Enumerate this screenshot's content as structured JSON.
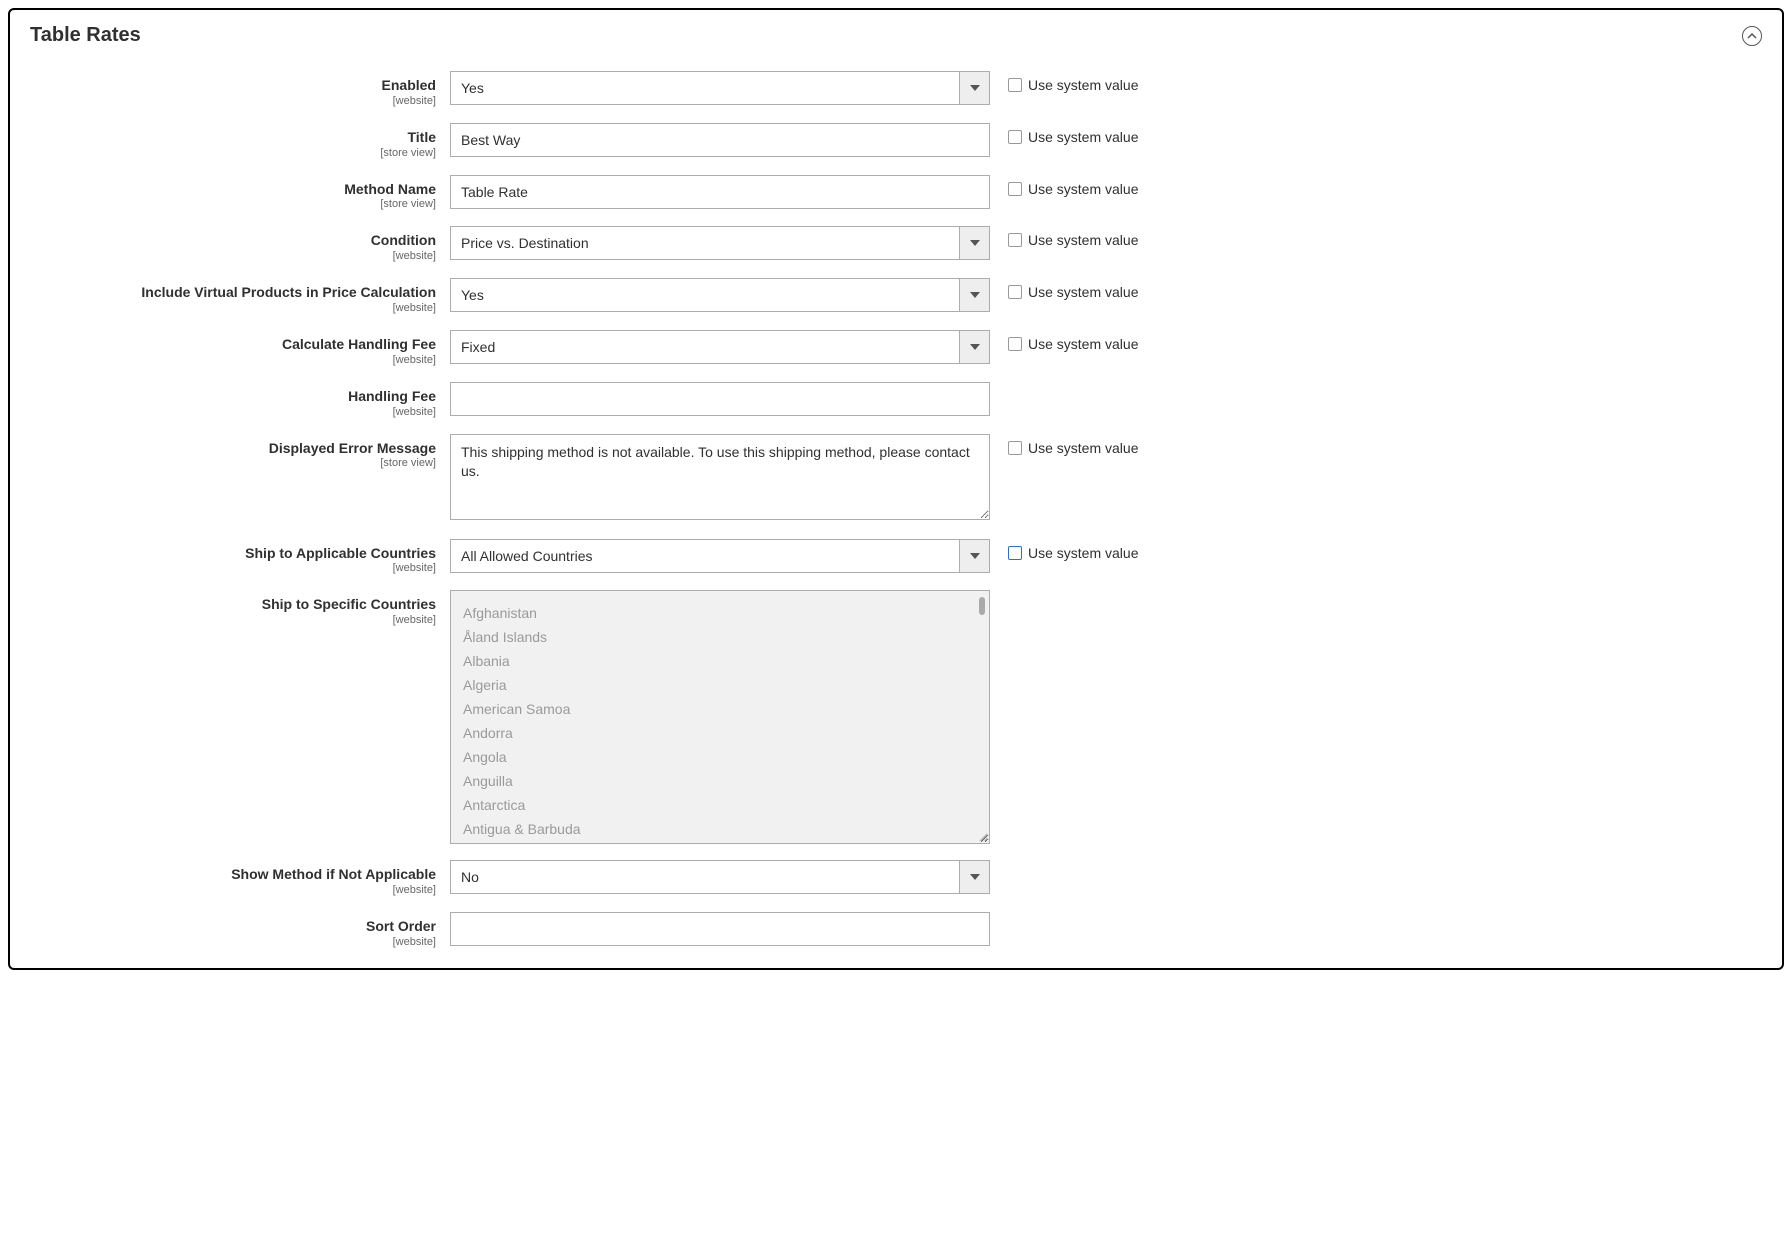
{
  "section": {
    "title": "Table Rates"
  },
  "scope": {
    "website": "[website]",
    "store_view": "[store view]"
  },
  "common": {
    "use_system_value": "Use system value"
  },
  "fields": {
    "enabled": {
      "label": "Enabled",
      "scope": "website",
      "type": "select",
      "value": "Yes",
      "sys": true
    },
    "title": {
      "label": "Title",
      "scope": "store_view",
      "type": "text",
      "value": "Best Way",
      "sys": true
    },
    "method": {
      "label": "Method Name",
      "scope": "store_view",
      "type": "text",
      "value": "Table Rate",
      "sys": true
    },
    "condition": {
      "label": "Condition",
      "scope": "website",
      "type": "select",
      "value": "Price vs. Destination",
      "sys": true
    },
    "virtual": {
      "label": "Include Virtual Products in Price Calculation",
      "scope": "website",
      "type": "select",
      "value": "Yes",
      "sys": true
    },
    "calc_fee": {
      "label": "Calculate Handling Fee",
      "scope": "website",
      "type": "select",
      "value": "Fixed",
      "sys": true
    },
    "fee": {
      "label": "Handling Fee",
      "scope": "website",
      "type": "text",
      "value": "",
      "sys": false
    },
    "errmsg": {
      "label": "Displayed Error Message",
      "scope": "store_view",
      "type": "textarea",
      "value": "This shipping method is not available. To use this shipping method, please contact us.",
      "sys": true
    },
    "applicable": {
      "label": "Ship to Applicable Countries",
      "scope": "website",
      "type": "select",
      "value": "All Allowed Countries",
      "sys": true,
      "sys_outlined": true
    },
    "specific": {
      "label": "Ship to Specific Countries",
      "scope": "website",
      "type": "multiselect",
      "options": [
        "Afghanistan",
        "Åland Islands",
        "Albania",
        "Algeria",
        "American Samoa",
        "Andorra",
        "Angola",
        "Anguilla",
        "Antarctica",
        "Antigua & Barbuda"
      ],
      "sys": false
    },
    "show_na": {
      "label": "Show Method if Not Applicable",
      "scope": "website",
      "type": "select",
      "value": "No",
      "sys": false
    },
    "sort": {
      "label": "Sort Order",
      "scope": "website",
      "type": "text",
      "value": "",
      "sys": false
    }
  }
}
